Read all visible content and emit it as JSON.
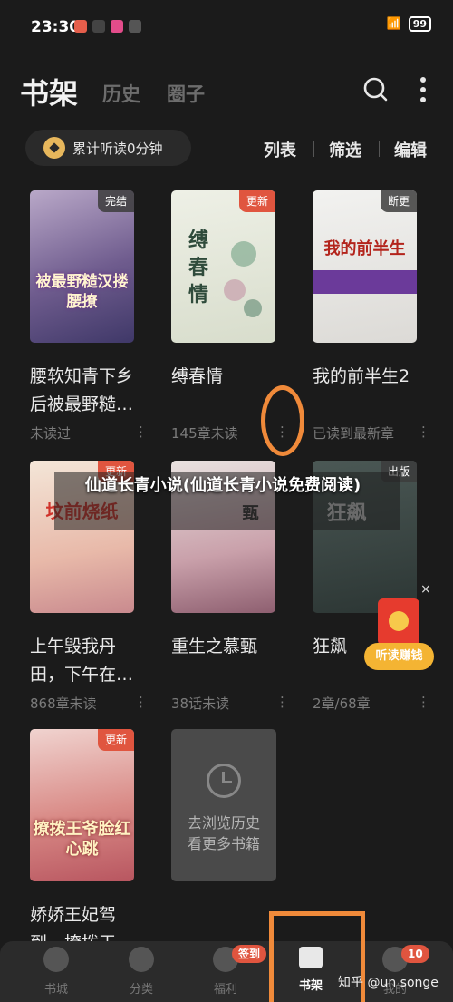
{
  "status_bar": {
    "time": "23:30",
    "battery": "99"
  },
  "header": {
    "tabs": [
      {
        "label": "书架"
      },
      {
        "label": "历史"
      },
      {
        "label": "圈子"
      }
    ]
  },
  "toolbar": {
    "listen_text": "累计听读0分钟",
    "list_label": "列表",
    "filter_label": "筛选",
    "edit_label": "编辑"
  },
  "books": [
    {
      "title": "腰软知青下乡后被最野糙…",
      "status": "未读过",
      "badge": "完结",
      "cover_text": "被最野糙汉搂腰撩"
    },
    {
      "title": "缚春情",
      "status": "145章未读",
      "badge": "更新",
      "cover_text": "缚春情"
    },
    {
      "title": "我的前半生2",
      "status": "已读到最新章",
      "badge": "断更",
      "cover_text": "我的前半生"
    },
    {
      "title": "上午毁我丹田，下午在…",
      "status": "868章未读",
      "badge": "更新",
      "cover_text": "坟前烧纸"
    },
    {
      "title": "重生之慕甄",
      "status": "38话未读",
      "badge": "",
      "cover_text": "甄"
    },
    {
      "title": "狂飙",
      "status": "2章/68章",
      "badge": "出版",
      "cover_text": "狂飙"
    },
    {
      "title": "娇娇王妃驾到，撩拨王…",
      "status": "",
      "badge": "更新",
      "cover_text": "撩拨王爷脸红心跳"
    }
  ],
  "history_card": {
    "line1": "去浏览历史",
    "line2": "看更多书籍"
  },
  "overlay_banner": "仙道长青小说(仙道长青小说免费阅读)",
  "red_packet": {
    "button": "听读赚钱",
    "close": "×"
  },
  "nav": {
    "items": [
      {
        "label": "书城",
        "icon": "compass-icon"
      },
      {
        "label": "分类",
        "icon": "grid-icon"
      },
      {
        "label": "福利",
        "icon": "gift-icon",
        "badge": "签到"
      },
      {
        "label": "书架",
        "icon": "book-icon"
      },
      {
        "label": "我的",
        "icon": "user-icon",
        "badge": "10"
      }
    ]
  },
  "watermark": "知乎 @un songe",
  "colors": {
    "accent": "#e0553f",
    "annotation": "#f08a3a",
    "background": "#1b1b1b"
  }
}
